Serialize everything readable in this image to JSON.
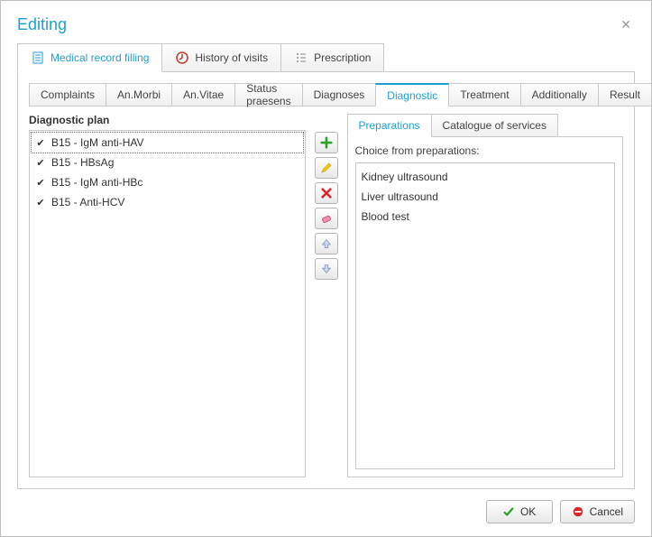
{
  "window": {
    "title": "Editing"
  },
  "top_tabs": {
    "medical_record": "Medical record filling",
    "history": "History of visits",
    "prescription": "Prescription"
  },
  "sub_tabs": {
    "complaints": "Complaints",
    "an_morbi": "An.Morbi",
    "an_vitae": "An.Vitae",
    "status_praesens": "Status praesens",
    "diagnoses": "Diagnoses",
    "diagnostic": "Diagnostic",
    "treatment": "Treatment",
    "additionally": "Additionally",
    "result": "Result"
  },
  "diagnostic": {
    "plan_title": "Diagnostic plan",
    "plan_items": [
      "B15 - IgM anti-HAV",
      "B15 - HBsAg",
      "B15 - IgM anti-HBc",
      "B15 - Anti-HCV"
    ],
    "right_tabs": {
      "preparations": "Preparations",
      "catalogue": "Catalogue of services"
    },
    "choice_label": "Choice from preparations:",
    "preparations": [
      "Kidney ultrasound",
      "Liver ultrasound",
      "Blood test"
    ]
  },
  "buttons": {
    "ok": "OK",
    "cancel": "Cancel"
  },
  "icons": {
    "add": "add-icon",
    "edit": "edit-icon",
    "delete": "delete-icon",
    "eraser": "eraser-icon",
    "up": "up-icon",
    "down": "down-icon"
  }
}
